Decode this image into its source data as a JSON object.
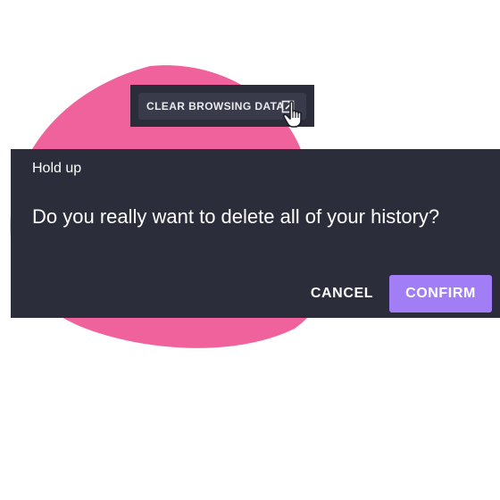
{
  "top_bar": {
    "clear_button_label": "CLEAR BROWSING DATA",
    "external_icon": "external-link-icon",
    "cursor_icon": "hand-pointer-icon"
  },
  "dialog": {
    "title": "Hold up",
    "message": "Do you really want to delete all of your history?",
    "cancel_label": "CANCEL",
    "confirm_label": "CONFIRM"
  },
  "colors": {
    "background": "#ffffff",
    "blob": "#f0629c",
    "panel": "#2b2d3a",
    "button_dark": "#393b4b",
    "accent": "#a27ef6",
    "text": "#ffffff"
  }
}
